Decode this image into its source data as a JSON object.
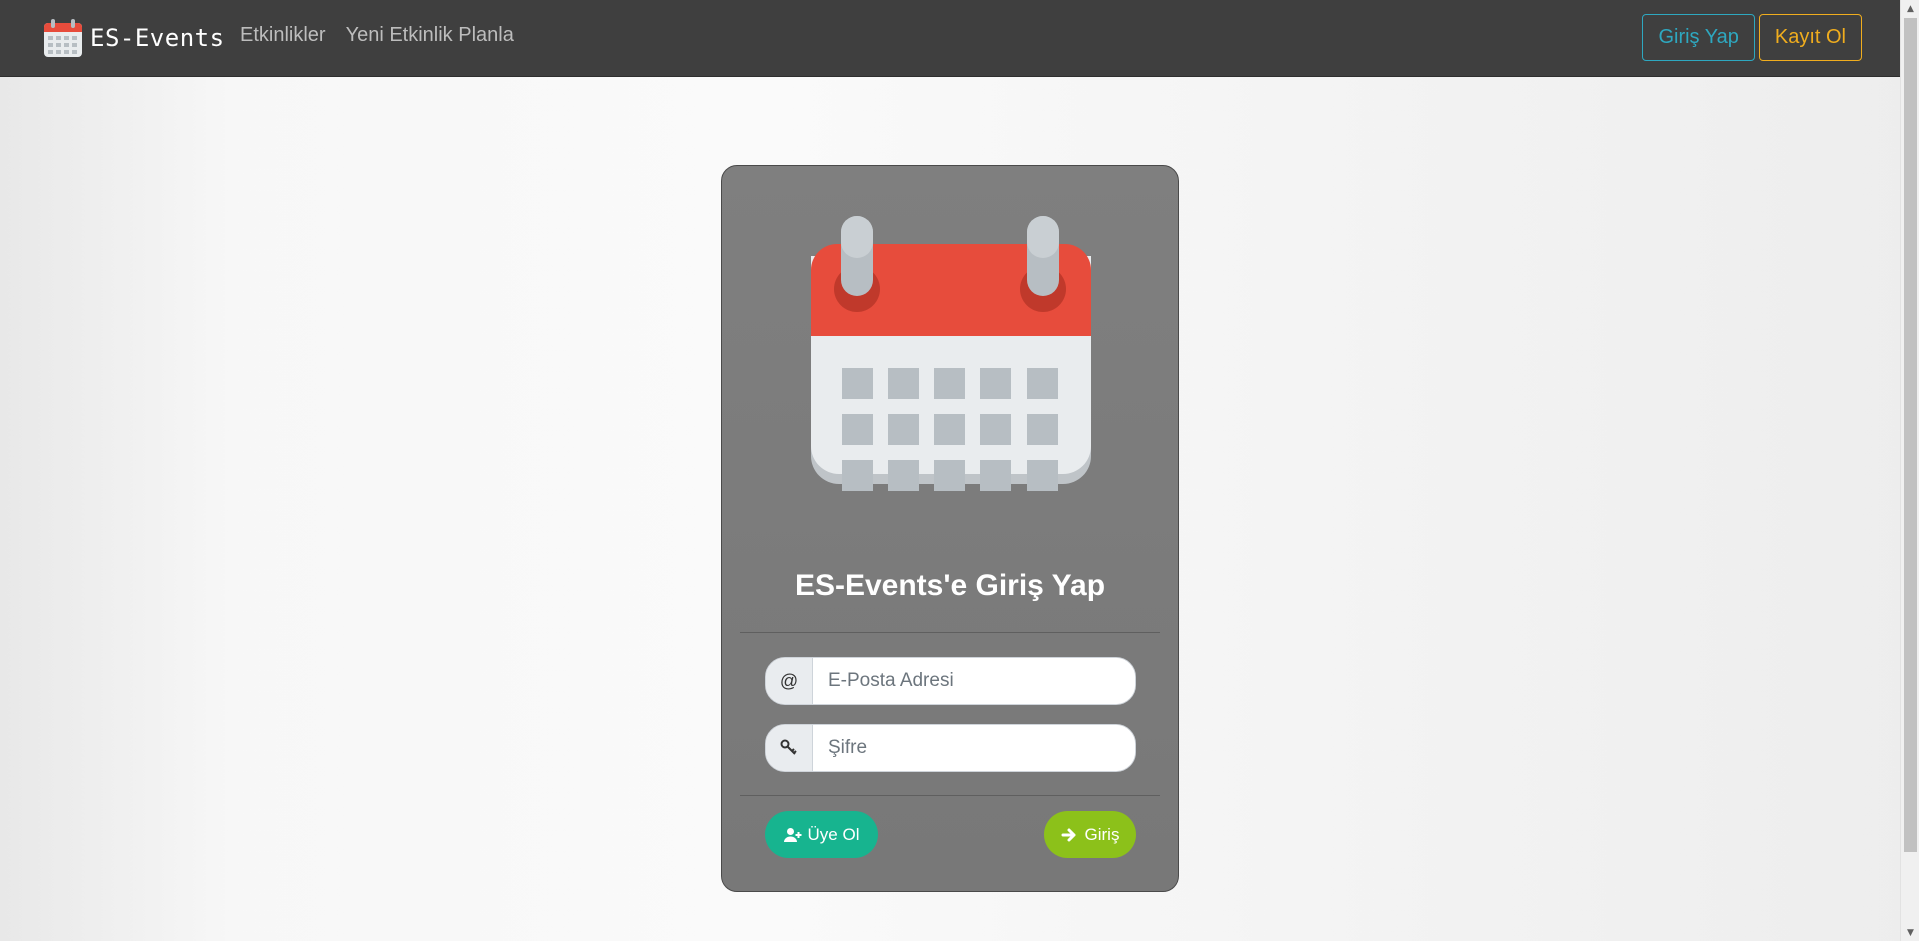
{
  "navbar": {
    "brand": "ES-Events",
    "links": [
      "Etkinlikler",
      "Yeni Etkinlik Planla"
    ],
    "login_label": "Giriş Yap",
    "register_label": "Kayıt Ol"
  },
  "login_card": {
    "title": "ES-Events'e Giriş Yap",
    "email_addon": "@",
    "email_placeholder": "E-Posta Adresi",
    "password_placeholder": "Şifre",
    "signup_label": "Üye Ol",
    "submit_label": "Giriş"
  },
  "colors": {
    "navbar_bg": "#3f3f3f",
    "login_outline": "#2ea8c0",
    "register_outline": "#f0ad1e",
    "signup_button": "#17b48f",
    "submit_button": "#8cc11a",
    "card_bg": "#7f7f7f"
  },
  "icons": {
    "brand": "calendar-icon",
    "email": "at-icon",
    "password": "key-icon",
    "signup": "user-plus-icon",
    "submit": "arrow-right-icon"
  }
}
